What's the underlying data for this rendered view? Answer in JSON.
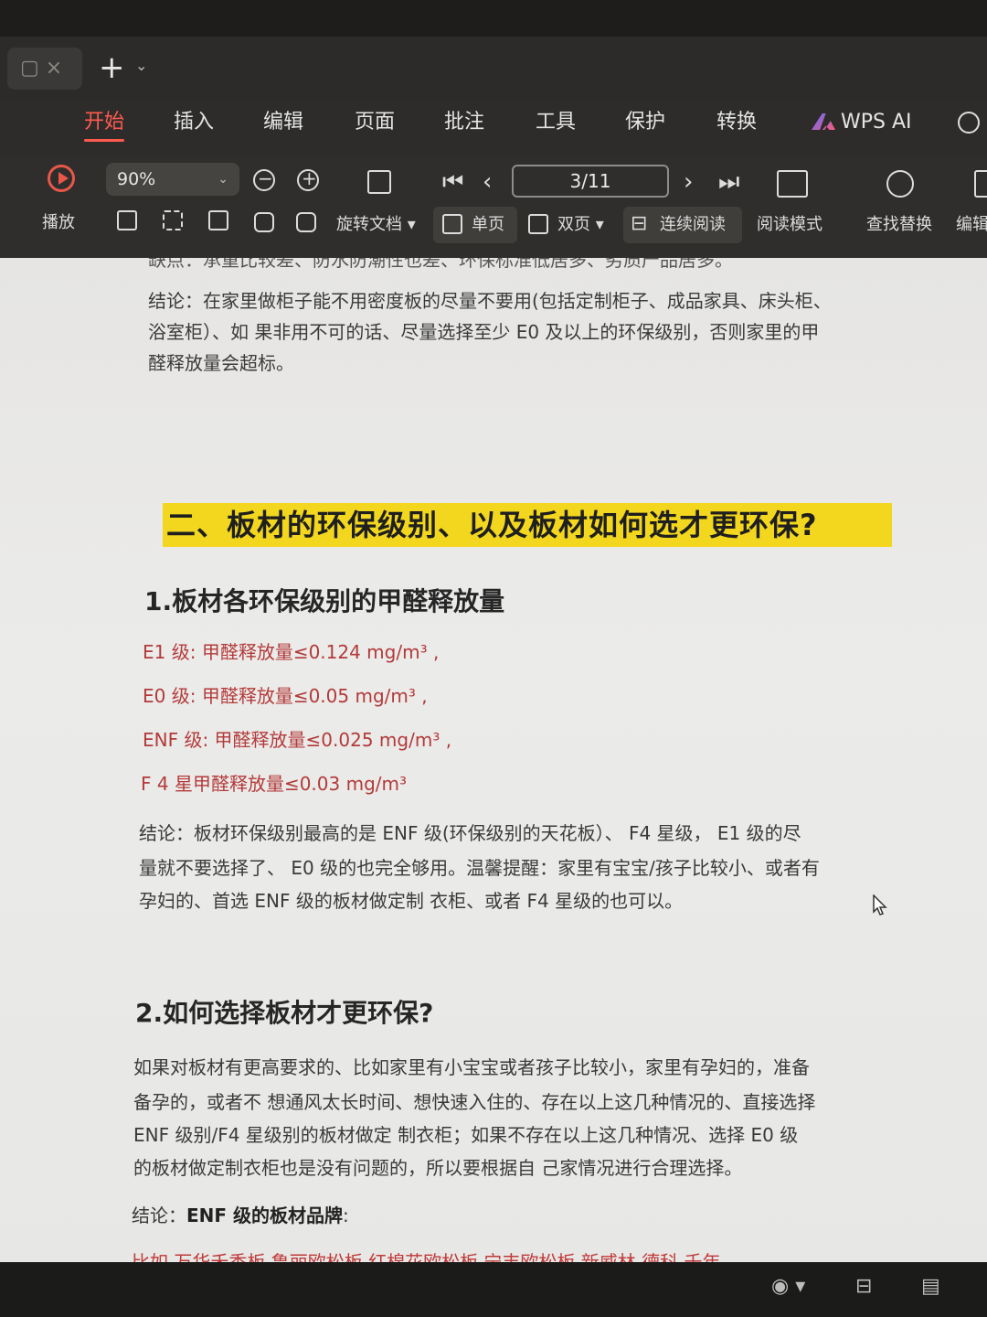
{
  "tabs": {
    "mini_tab": "▢ ×",
    "add": "+",
    "add_arrow": "⌄"
  },
  "menu": {
    "items": [
      "开始",
      "插入",
      "编辑",
      "页面",
      "批注",
      "工具",
      "保护",
      "转换"
    ],
    "ai_label": "WPS AI"
  },
  "toolbar": {
    "play": "播放",
    "zoom": "90%",
    "rotate": "旋转文档",
    "single_page": "单页",
    "double_page": "双页",
    "continuous": "连续阅读",
    "read_mode": "阅读模式",
    "find_replace": "查找替换",
    "edit": "编辑",
    "page_indicator": "3/11"
  },
  "document": {
    "cut_top": "缺点：承重比较差、防水防潮性也差、环保标准低居多、劣质产品居多。",
    "conclusion1": [
      "结论：在家里做柜子能不用密度板的尽量不要用(包括定制柜子、成品家具、床头柜、",
      "浴室柜）、如  果非用不可的话、尽量选择至少  E0  及以上的环保级别，否则家里的甲",
      "醛释放量会超标。"
    ],
    "section_heading": "二、板材的环保级别、以及板材如何选才更环保?",
    "sub1": "1.板材各环保级别的甲醛释放量",
    "levels": [
      "E1  级:   甲醛释放量≤0.124  mg/m³  ,",
      "E0  级:   甲醛释放量≤0.05  mg/m³  ,",
      "ENF  级:   甲醛释放量≤0.025  mg/m³  ,",
      "F 4   星甲醛释放量≤0.03  mg/m³"
    ],
    "conclusion2": [
      "结论：板材环保级别最高的是  ENF  级(环保级别的天花板）、   F4  星级，    E1  级的尽",
      "量就不要选择了、  E0  级的也完全够用。温馨提醒：家里有宝宝/孩子比较小、或者有",
      "孕妇的、首选  ENF  级的板材做定制  衣柜、或者  F4  星级的也可以。"
    ],
    "sub2": "2.如何选择板材才更环保?",
    "para2": [
      "如果对板材有更高要求的、比如家里有小宝宝或者孩子比较小，家里有孕妇的，准备",
      "备孕的，或者不  想通风太长时间、想快速入住的、存在以上这几种情况的、直接选择",
      "ENF  级别/F4  星级别的板材做定  制衣柜；如果不存在以上这几种情况、选择  E0  级",
      "的板材做定制衣柜也是没有问题的，所以要根据自  己家情况进行合理选择。"
    ],
    "conclusion3_prefix": "结论：",
    "conclusion3_bold": "ENF  级的板材品牌",
    "conclusion3_suffix": ":",
    "cut_bottom": "比如    万华禾香板    鲁丽欧松板    红棉花欧松板    宁丰欧松板    新威林    德科    千年"
  },
  "colors": {
    "accent": "#ff5a4e",
    "highlight": "#f3d71f",
    "red_text": "#b33a3a"
  }
}
